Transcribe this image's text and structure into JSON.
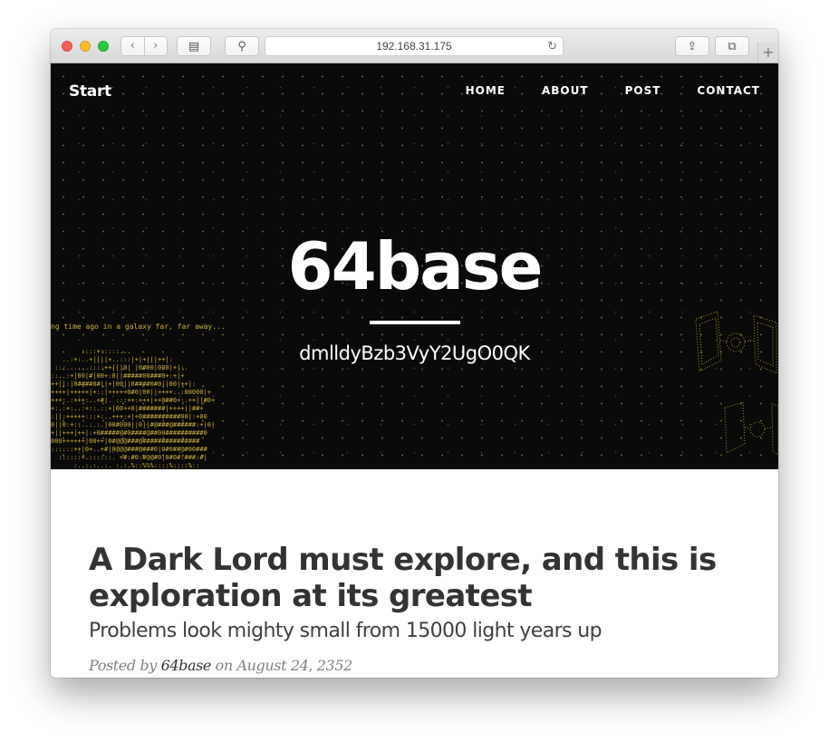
{
  "browser": {
    "url": "192.168.31.175",
    "reload_glyph": "↻",
    "back_glyph": "‹",
    "forward_glyph": "›",
    "new_tab_glyph": "+",
    "share_glyph": "⇪",
    "tabs_glyph": "⧉",
    "sidebar_glyph": "▤",
    "extension_glyph": "⚲"
  },
  "site": {
    "brand": "Start",
    "nav": [
      {
        "label": "HOME"
      },
      {
        "label": "ABOUT"
      },
      {
        "label": "POST"
      },
      {
        "label": "CONTACT"
      }
    ]
  },
  "hero": {
    "title": "64base",
    "subtitle": "dmlldyBzb3VyY2UgO0QK",
    "crawl_text": "ng time ago in a galaxy far, far away...",
    "ascii_art": "        ::::+:::::...\n   ..:+:..+||||+..:::|+|+|||++|:\n :::......::::++|||0| |0#00|000|+|:.\n::..:+|00|#|00+:0||#####00###0+:+|+\n++||:|0####0#||+|00||0####0#0||00|++|:\n++++|+++++|+::|+++++0#0|00||++++..:00000|+\n+++:.:+++:..+#|. :::++:+++|++0##0+:.++||#0+\n+:.:+:..:+::.::+|00++0|#######|++++||##+\n:||:+++++:::+:..+++:+|+0##########00|:+00\n0||0:+::..:.:.|00#000||0||#@###@######:+|0|\n+||+++|++|:+0#####@#0####@##00##########0\n000++++++|00++|0#@@@###@###############\n::::::++|0+..+#|0@@@###@###0|0#0##@#00###\n  ::::::+.::::::. +#:#0:#@@#0|0#0#:###:#|\n      :..:.:..:. :.:.%::%%%::::%::::%::\n              :..:.:.  :.:.:.",
    "stars_color": "#d2aa5a",
    "ascii_color": "#cfae43"
  },
  "post": {
    "title": "A Dark Lord must explore, and this is exploration at its greatest",
    "subtitle": "Problems look mighty small from 15000 light years up",
    "meta_prefix": "Posted by ",
    "author": "64base",
    "meta_on": " on ",
    "date": "August 24, 2352"
  },
  "colors": {
    "hero_bg": "#0a0a0a",
    "title_text": "#333333",
    "meta_text": "#808080"
  }
}
